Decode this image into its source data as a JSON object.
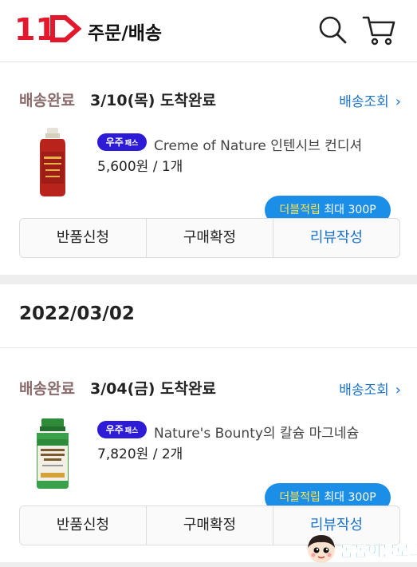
{
  "header": {
    "logo_text": "11",
    "title": "주문/배송",
    "brand_color": "#e3182d",
    "search_icon": "search-icon",
    "cart_icon": "cart-icon"
  },
  "orders": [
    {
      "status": "배송완료",
      "arrival": "3/10(목) 도착완료",
      "track_label": "배송조회",
      "badge": "우주",
      "badge_small": "패스",
      "product_name": "Creme of Nature 인텐시브 컨디셔",
      "price_qty": "5,600원 / 1개",
      "tooltip_highlight": "더블적립",
      "tooltip_rest": " 최대 300P",
      "buttons": [
        "반품신청",
        "구매확정",
        "리뷰작성"
      ]
    },
    {
      "status": "배송완료",
      "arrival": "3/04(금) 도착완료",
      "track_label": "배송조회",
      "badge": "우주",
      "badge_small": "패스",
      "product_name": "Nature's Bounty의 칼슘 마그네슘",
      "price_qty": "7,820원 / 2개",
      "tooltip_highlight": "더블적립",
      "tooltip_rest": " 최대 300P",
      "buttons": [
        "반품신청",
        "구매확정",
        "리뷰작성"
      ]
    }
  ],
  "date_group": "2022/03/02",
  "watermark": "돔돔이블로그"
}
